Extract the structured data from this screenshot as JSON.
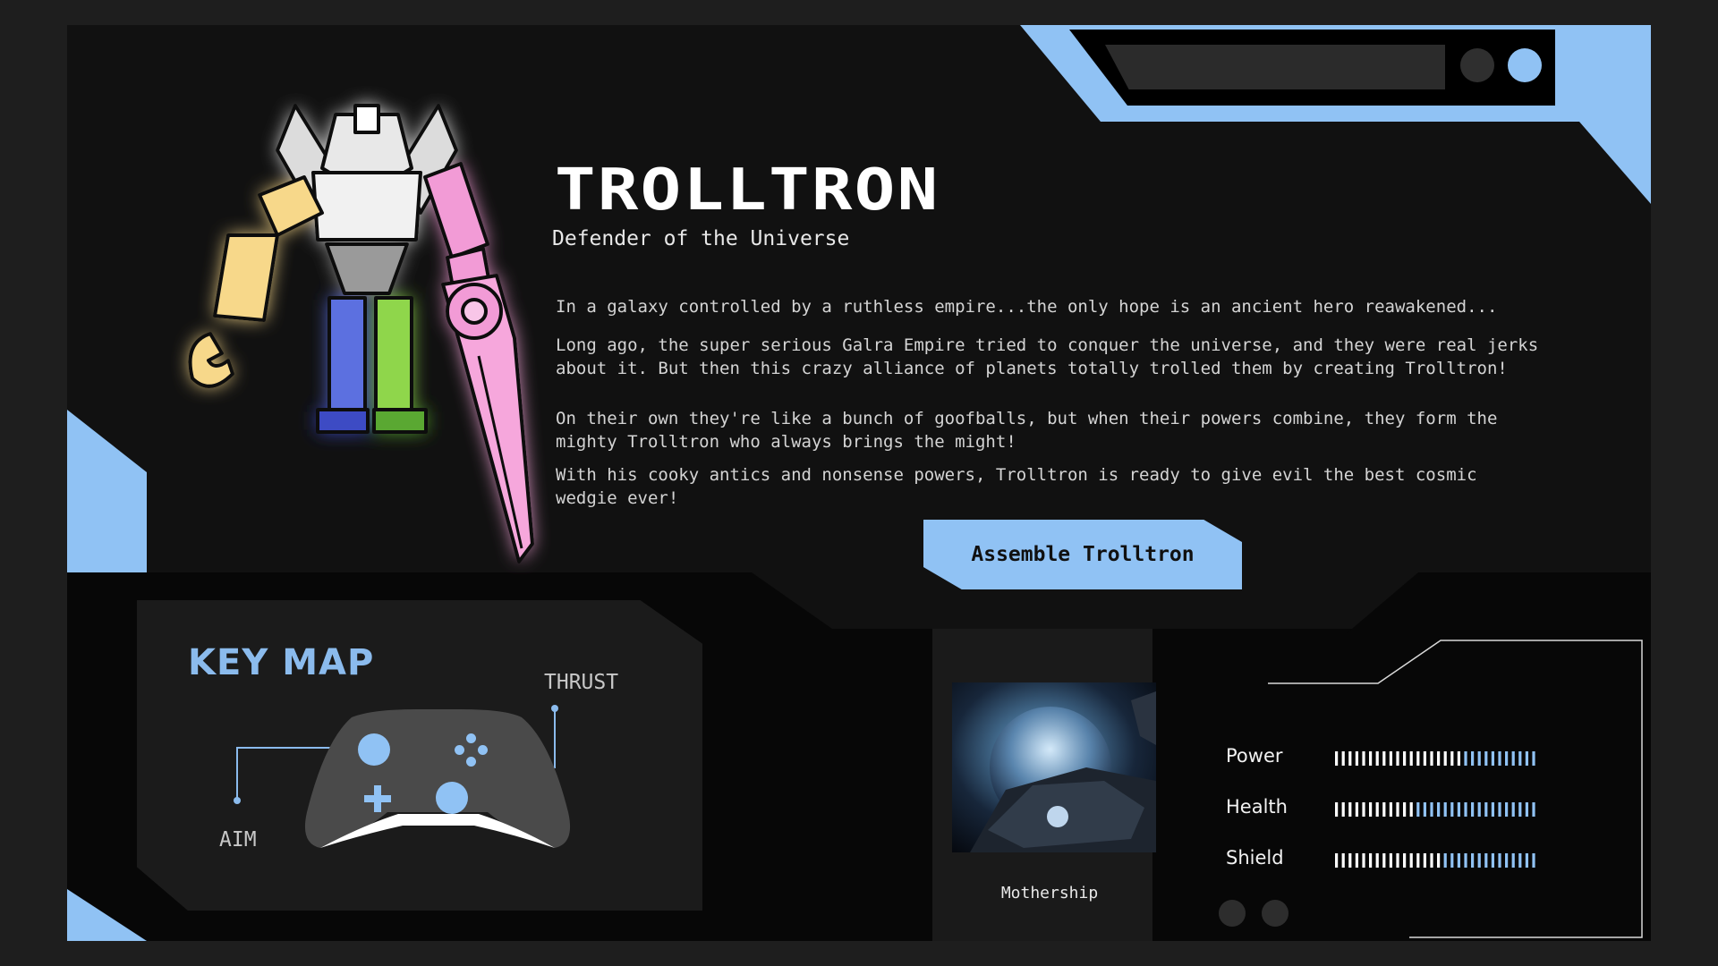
{
  "header": {
    "title": "TROLLTRON",
    "subtitle": "Defender of the Universe",
    "search_placeholder": ""
  },
  "story": {
    "intro": "In a galaxy controlled by a ruthless empire...the only hope is an ancient hero reawakened...",
    "paragraph_1": "Long ago, the super serious Galra Empire tried to conquer the universe, and they were real jerks\nabout it. But then this crazy alliance of planets totally trolled them by creating Trolltron!",
    "paragraph_2": "On their own they're like a bunch of goofballs, but when their powers combine, they form the\nmighty Trolltron who always brings the might!",
    "paragraph_3": "With his cooky antics and nonsense powers, Trolltron is ready to give evil the best cosmic\nwedgie ever!"
  },
  "actions": {
    "assemble_label": "Assemble Trolltron"
  },
  "keymap": {
    "title": "KEY MAP",
    "thrust_label": "THRUST",
    "aim_label": "AIM"
  },
  "mothership": {
    "caption": "Mothership"
  },
  "stats": [
    {
      "label": "Power",
      "value": 0.62
    },
    {
      "label": "Health",
      "value": 0.4
    },
    {
      "label": "Shield",
      "value": 0.52
    }
  ],
  "colors": {
    "accent": "#90c2f4",
    "panel": "#111111",
    "background": "#1e1e1e",
    "robot_yellow": "#f7d88a",
    "robot_pink": "#f29bd6",
    "robot_blue": "#5b6fe0",
    "robot_green": "#8fd64b"
  }
}
